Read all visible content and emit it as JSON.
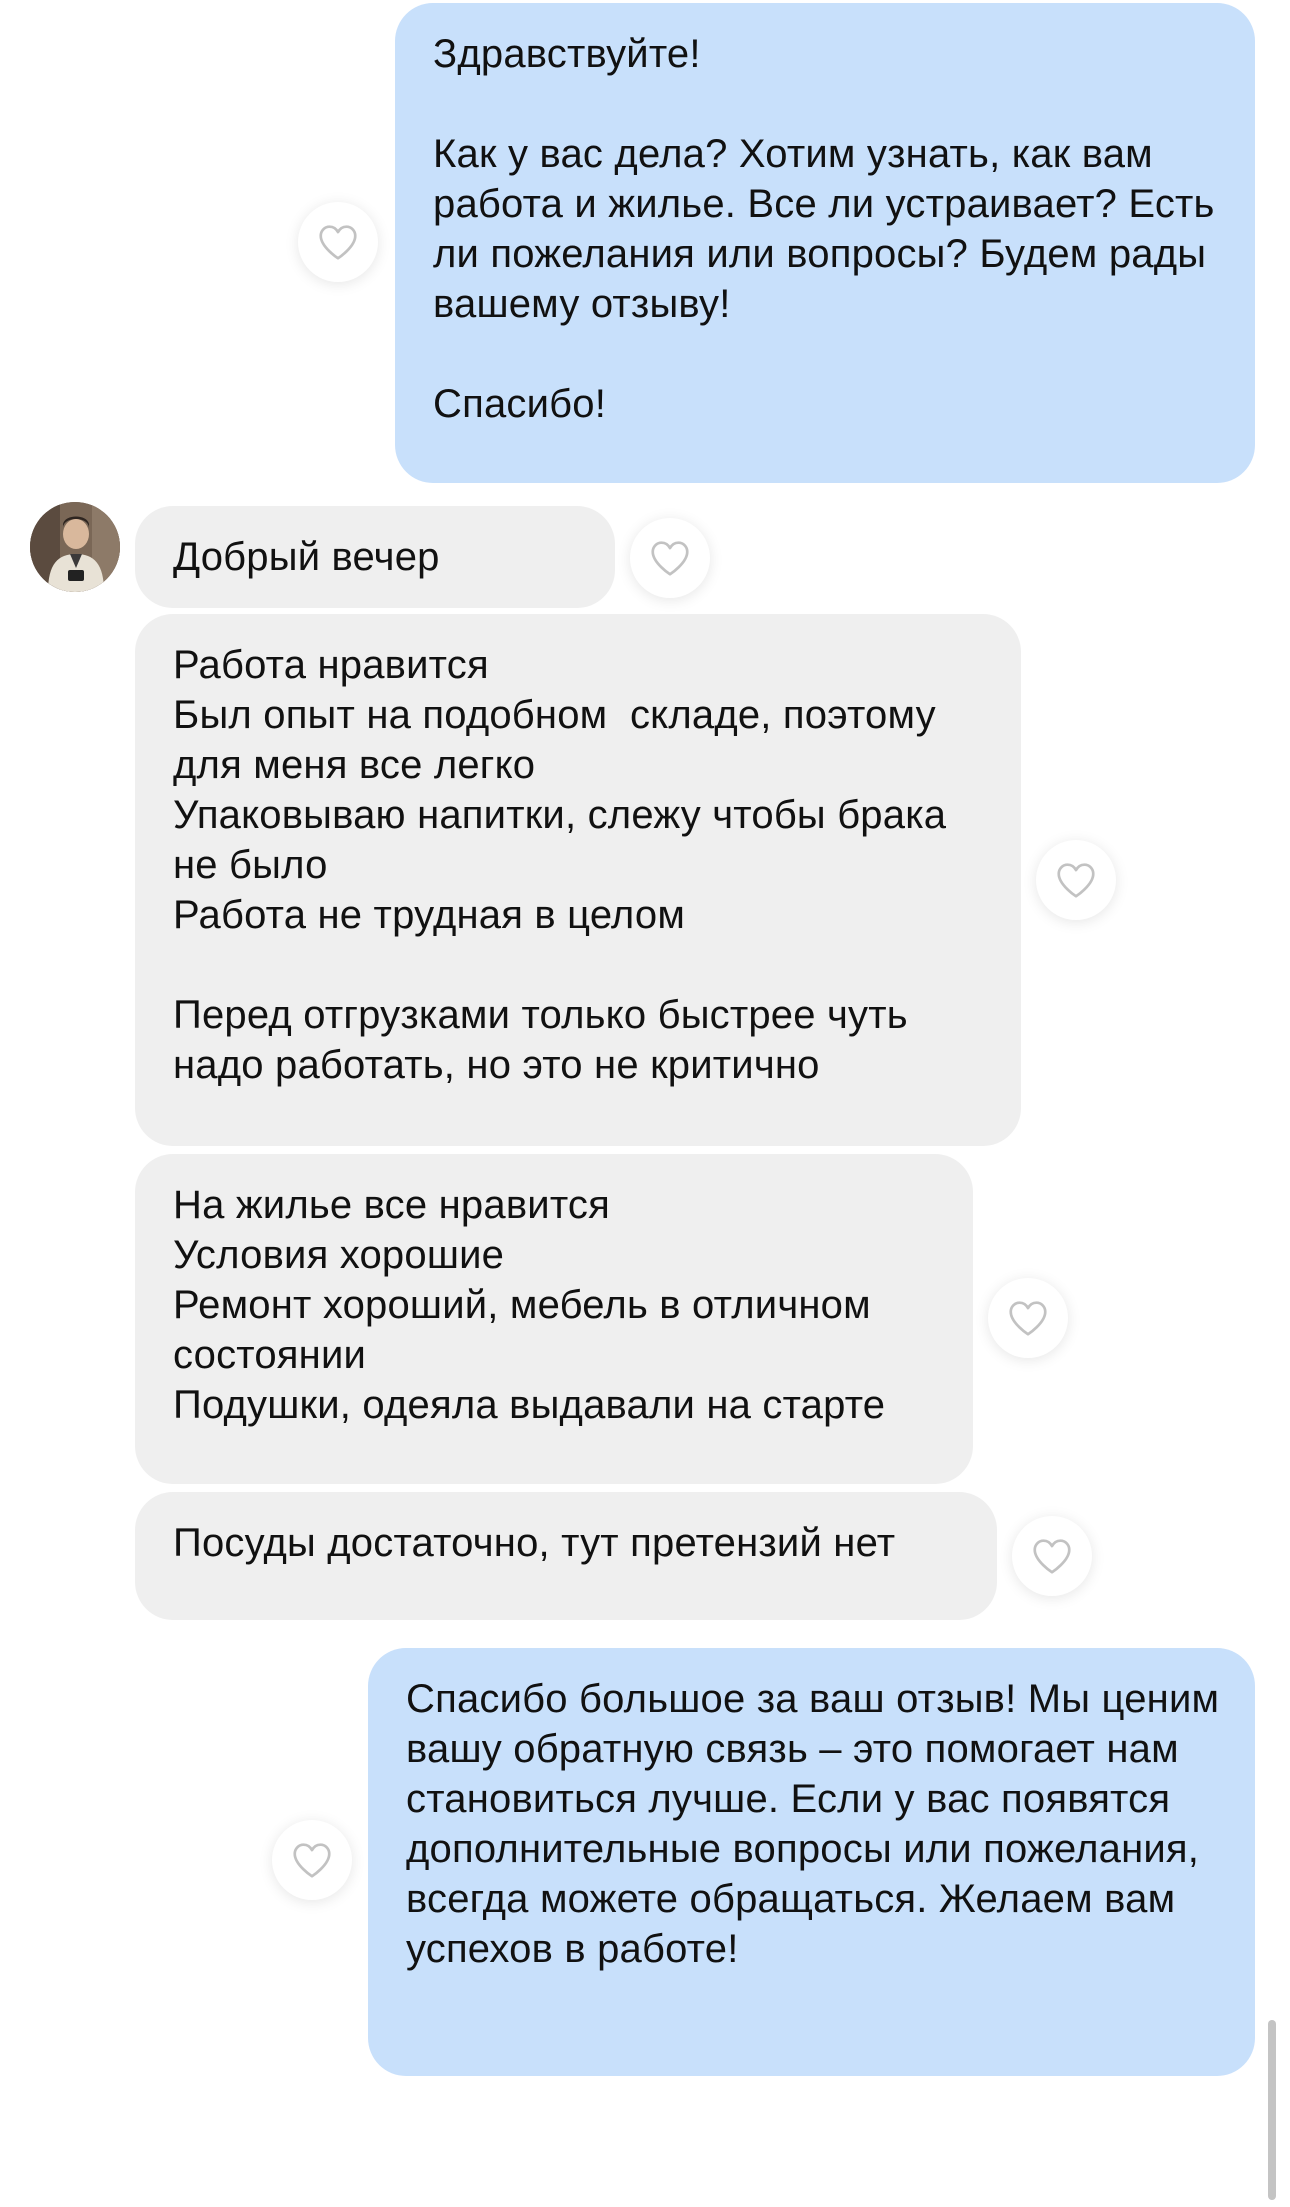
{
  "messages": [
    {
      "direction": "outgoing",
      "text": "Здравствуйте!\n\nКак у вас дела? Хотим узнать, как вам работа и жилье. Все ли устраивает? Есть ли пожелания или вопросы? Будем рады вашему отзыву!\n\nСпасибо!"
    },
    {
      "direction": "incoming",
      "text": "Добрый вечер"
    },
    {
      "direction": "incoming",
      "text": "Работа нравится\nБыл опыт на подобном  складе, поэтому для меня все легко\nУпаковываю напитки, слежу чтобы брака не было\nРабота не трудная в целом\n\nПеред отгрузками только быстрее чуть надо работать, но это не критично"
    },
    {
      "direction": "incoming",
      "text": "На жилье все нравится\nУсловия хорошие\nРемонт хороший, мебель в отличном состоянии\nПодушки, одеяла выдавали на старте"
    },
    {
      "direction": "incoming",
      "text": "Посуды достаточно, тут претензий нет"
    },
    {
      "direction": "outgoing",
      "text": "Спасибо большое за ваш отзыв! Мы ценим вашу обратную связь – это помогает нам становиться лучше. Если у вас появятся дополнительные вопросы или пожелания, всегда можете обращаться. Желаем вам успехов в работе!"
    }
  ],
  "icons": {
    "reaction": "heart-outline-icon",
    "avatar": "contact-avatar"
  },
  "colors": {
    "outgoing_bubble": "#c8e0fb",
    "incoming_bubble": "#efefef",
    "heart_stroke": "#c2c2c2"
  }
}
